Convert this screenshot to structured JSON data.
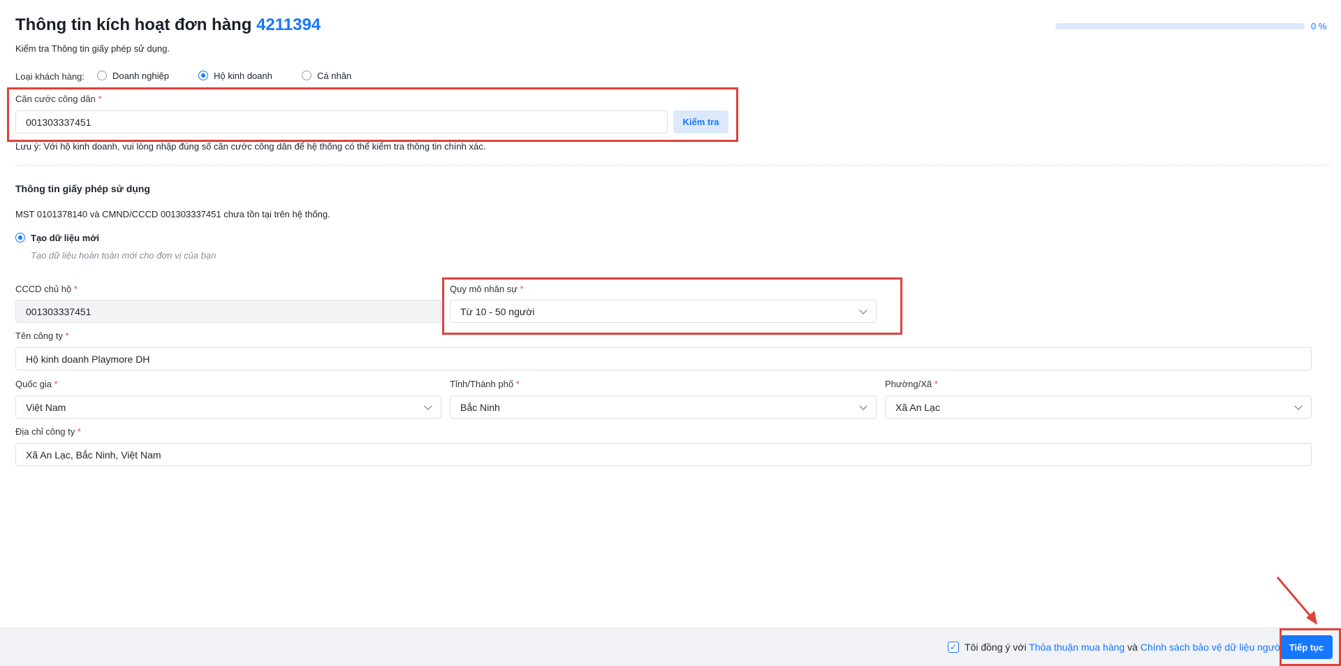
{
  "header": {
    "title": "Thông tin kích hoạt đơn hàng",
    "order_number": "4211394",
    "subtitle": "Kiểm tra Thông tin giấy phép sử dụng.",
    "progress_percent": 0,
    "progress_label": "0 %"
  },
  "customer_type": {
    "label": "Loại khách hàng:",
    "options": [
      "Doanh nghiệp",
      "Hộ kinh doanh",
      "Cá nhân"
    ],
    "selected": "Hộ kinh doanh"
  },
  "id_check": {
    "label": "Căn cước công dân",
    "required": "*",
    "value": "001303337451",
    "button": "Kiểm tra",
    "note": "Lưu ý: Với hộ kinh doanh, vui lòng nhập đúng số căn cước công dân để hệ thống có thể kiểm tra thông tin chính xác."
  },
  "license": {
    "title": "Thông tin giấy phép sử dụng",
    "status": "MST 0101378140 và CMND/CCCD 001303337451 chưa tồn tại trên hệ thống.",
    "option_label": "Tạo dữ liệu mới",
    "option_desc": "Tạo dữ liệu hoàn toàn mới cho đơn vị của bạn"
  },
  "form": {
    "cccd": {
      "label": "CCCD chủ hộ",
      "value": "001303337451"
    },
    "staff": {
      "label": "Quy mô nhân sự",
      "value": "Từ 10 - 50 người"
    },
    "company": {
      "label": "Tên công ty",
      "value": "Hộ kinh doanh Playmore DH"
    },
    "country": {
      "label": "Quốc gia",
      "value": "Việt Nam"
    },
    "province": {
      "label": "Tỉnh/Thành phố",
      "value": "Bắc Ninh"
    },
    "ward": {
      "label": "Phường/Xã",
      "value": "Xã An Lạc"
    },
    "address": {
      "label": "Địa chỉ công ty",
      "value": "Xã An Lạc, Bắc Ninh, Việt Nam"
    }
  },
  "footer": {
    "agree_prefix": "Tôi đồng ý với",
    "link1": "Thỏa thuận mua hàng",
    "and": "và",
    "link2": "Chính sách bảo vệ dữ liệu người dùng",
    "continue": "Tiếp tục",
    "agreed": true
  }
}
